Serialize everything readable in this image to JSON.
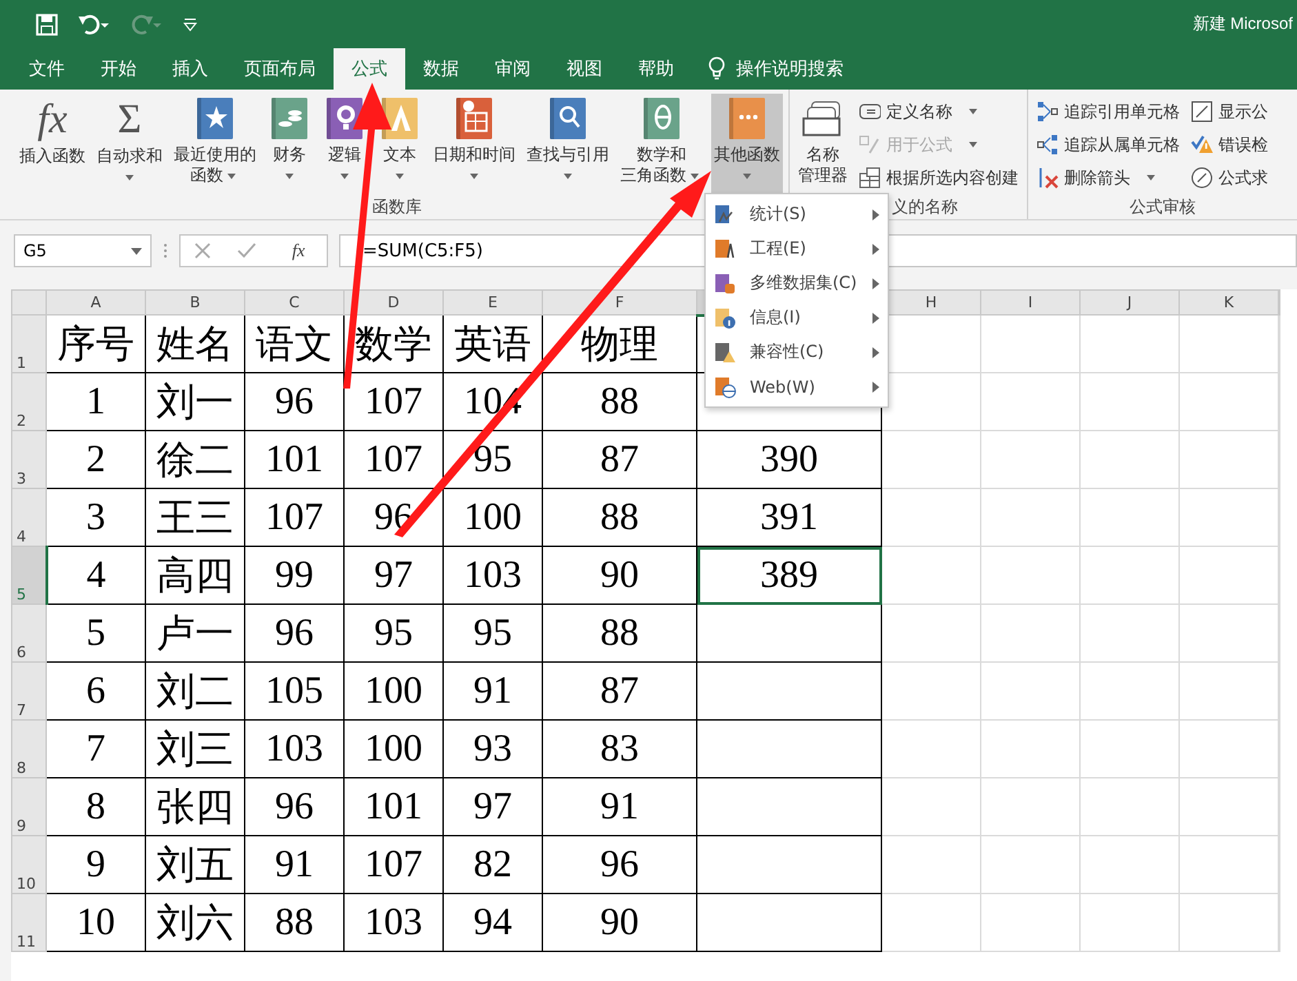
{
  "title_bar": {
    "title": "新建 Microsof"
  },
  "tabs": [
    {
      "label": "文件",
      "selected": false
    },
    {
      "label": "开始",
      "selected": false
    },
    {
      "label": "插入",
      "selected": false
    },
    {
      "label": "页面布局",
      "selected": false
    },
    {
      "label": "公式",
      "selected": true
    },
    {
      "label": "数据",
      "selected": false
    },
    {
      "label": "审阅",
      "selected": false
    },
    {
      "label": "视图",
      "selected": false
    },
    {
      "label": "帮助",
      "selected": false
    }
  ],
  "tell_me": {
    "label": "操作说明搜索"
  },
  "ribbon_groups": [
    {
      "label": "函数库",
      "buttons": [
        {
          "kind": "large",
          "icon_text": "fx",
          "lines": [
            "插入函数"
          ],
          "dropdown": false,
          "pressed": false
        },
        {
          "kind": "large",
          "icon_text": "Σ",
          "lines": [
            "自动求和"
          ],
          "dropdown": true,
          "pressed": false
        },
        {
          "kind": "large",
          "lines": [
            "最近使用的",
            "函数"
          ],
          "dropdown": true,
          "pressed": false
        },
        {
          "kind": "large",
          "lines": [
            "财务"
          ],
          "dropdown": true,
          "pressed": false
        },
        {
          "kind": "large",
          "lines": [
            "逻辑"
          ],
          "dropdown": true,
          "pressed": false
        },
        {
          "kind": "large",
          "lines": [
            "文本"
          ],
          "dropdown": true,
          "pressed": false
        },
        {
          "kind": "large",
          "lines": [
            "日期和时间"
          ],
          "dropdown": true,
          "pressed": false
        },
        {
          "kind": "large",
          "lines": [
            "查找与引用"
          ],
          "dropdown": true,
          "pressed": false
        },
        {
          "kind": "large",
          "lines": [
            "数学和",
            "三角函数"
          ],
          "dropdown": true,
          "pressed": false
        },
        {
          "kind": "large",
          "lines": [
            "其他函数"
          ],
          "dropdown": true,
          "pressed": true
        }
      ]
    },
    {
      "label": "义的名称",
      "buttons": [
        {
          "kind": "large",
          "lines": [
            "名称",
            "管理器"
          ],
          "dropdown": false,
          "pressed": false
        },
        {
          "kind": "column",
          "items": [
            {
              "label": "定义名称",
              "dropdown": true,
              "disabled": false
            },
            {
              "label": "用于公式",
              "dropdown": true,
              "disabled": true
            },
            {
              "label": "根据所选内容创建",
              "dropdown": false,
              "disabled": false
            }
          ]
        }
      ]
    },
    {
      "label": "公式审核",
      "buttons": [
        {
          "kind": "column",
          "items": [
            {
              "label": "追踪引用单元格",
              "dropdown": false,
              "disabled": false
            },
            {
              "label": "追踪从属单元格",
              "dropdown": false,
              "disabled": false
            },
            {
              "label": "删除箭头",
              "dropdown": true,
              "disabled": false
            }
          ]
        },
        {
          "kind": "column",
          "items": [
            {
              "label": "显示公",
              "dropdown": false,
              "disabled": false
            },
            {
              "label": "错误检",
              "dropdown": false,
              "disabled": false
            },
            {
              "label": "公式求",
              "dropdown": false,
              "disabled": false
            }
          ]
        }
      ]
    }
  ],
  "menu": {
    "items": [
      {
        "label": "统计(S)"
      },
      {
        "label": "工程(E)"
      },
      {
        "label": "多维数据集(C)"
      },
      {
        "label": "信息(I)"
      },
      {
        "label": "兼容性(C)"
      },
      {
        "label": "Web(W)"
      }
    ]
  },
  "formula_bar": {
    "name_box": "G5",
    "fx": "fx",
    "formula": "=SUM(C5:F5)"
  },
  "sheet": {
    "columns": [
      {
        "label": "A",
        "selected": false
      },
      {
        "label": "B",
        "selected": false
      },
      {
        "label": "C",
        "selected": false
      },
      {
        "label": "D",
        "selected": false
      },
      {
        "label": "E",
        "selected": false
      },
      {
        "label": "F",
        "selected": false
      },
      {
        "selected": true
      },
      {
        "label": "H",
        "selected": false
      },
      {
        "label": "I",
        "selected": false
      },
      {
        "label": "J",
        "selected": false
      },
      {
        "label": "K",
        "selected": false
      }
    ],
    "rows": [
      {
        "number": "1",
        "selected": false,
        "cells": [
          "序号",
          "姓名",
          "语文",
          "数学",
          "英语",
          "物理"
        ]
      },
      {
        "number": "2",
        "selected": false,
        "cells": [
          "1",
          "刘一",
          "96",
          "107",
          "104",
          "88"
        ]
      },
      {
        "number": "3",
        "selected": false,
        "cells": [
          "2",
          "徐二",
          "101",
          "107",
          "95",
          "87",
          "390"
        ]
      },
      {
        "number": "4",
        "selected": false,
        "cells": [
          "3",
          "王三",
          "107",
          "96",
          "100",
          "88",
          "391"
        ]
      },
      {
        "number": "5",
        "selected": true,
        "cells": [
          "4",
          "高四",
          "99",
          "97",
          "103",
          "90",
          "389"
        ]
      },
      {
        "number": "6",
        "selected": false,
        "cells": [
          "5",
          "卢一",
          "96",
          "95",
          "95",
          "88"
        ]
      },
      {
        "number": "7",
        "selected": false,
        "cells": [
          "6",
          "刘二",
          "105",
          "100",
          "91",
          "87"
        ]
      },
      {
        "number": "8",
        "selected": false,
        "cells": [
          "7",
          "刘三",
          "103",
          "100",
          "93",
          "83"
        ]
      },
      {
        "number": "9",
        "selected": false,
        "cells": [
          "8",
          "张四",
          "96",
          "101",
          "97",
          "91"
        ]
      },
      {
        "number": "10",
        "selected": false,
        "cells": [
          "9",
          "刘五",
          "91",
          "107",
          "82",
          "96"
        ]
      },
      {
        "number": "11",
        "selected": false,
        "cells": [
          "10",
          "刘六",
          "88",
          "103",
          "94",
          "90"
        ]
      }
    ]
  }
}
